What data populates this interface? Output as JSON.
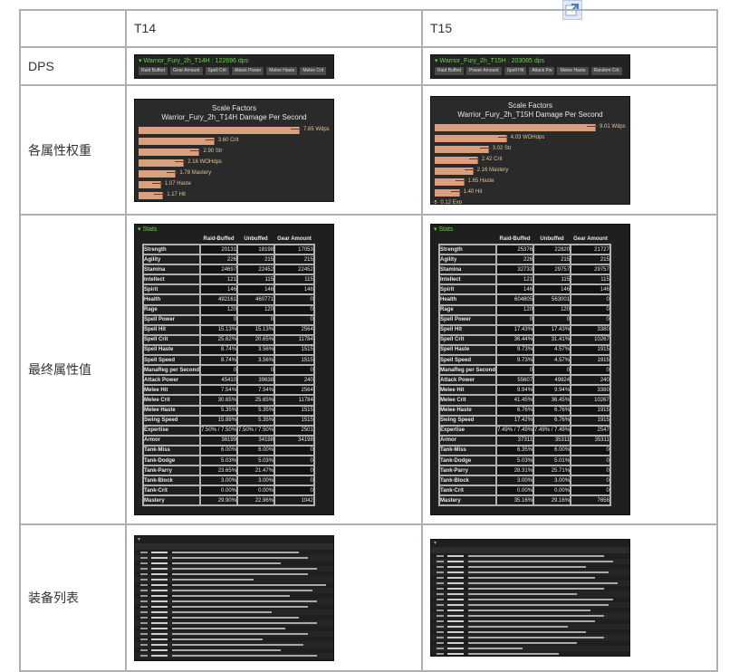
{
  "columns": {
    "t14": "T14",
    "t15": "T15"
  },
  "rows": {
    "dps": "DPS",
    "scale_factors": "各属性权重",
    "final_stats": "最终属性值",
    "gear_list": "装备列表"
  },
  "t14": {
    "dps_title": "Warrior_Fury_2h_T14H : 122696 dps",
    "dps_buttons": [
      "Raid Buffed",
      "Gear Amount",
      "Spell Crit",
      "Attack Power",
      "Melee Haste",
      "Melee Crit"
    ],
    "scale_factors": {
      "title": "Scale Factors",
      "subtitle": "Warrior_Fury_2h_T14H Damage Per Second",
      "items": [
        {
          "label": "7.65 Wdps",
          "value": 7.65
        },
        {
          "label": "3.60 Crit",
          "value": 3.6
        },
        {
          "label": "2.90 Str",
          "value": 2.9
        },
        {
          "label": "2.16 WOHdps",
          "value": 2.16
        },
        {
          "label": "1.78 Mastery",
          "value": 1.78
        },
        {
          "label": "1.07 Haste",
          "value": 1.07
        },
        {
          "label": "1.17 Hit",
          "value": 1.17
        }
      ]
    },
    "stats": {
      "header": "Stats",
      "columns": [
        "Raid-Buffed",
        "Unbuffed",
        "Gear Amount"
      ],
      "rows": [
        {
          "name": "Strength",
          "v": [
            "20131",
            "18198",
            "17053"
          ]
        },
        {
          "name": "Agility",
          "v": [
            "226",
            "215",
            "215"
          ]
        },
        {
          "name": "Stamina",
          "v": [
            "24697",
            "22452",
            "22452"
          ]
        },
        {
          "name": "Intellect",
          "v": [
            "121",
            "115",
            "115"
          ]
        },
        {
          "name": "Spirit",
          "v": [
            "146",
            "146",
            "146"
          ]
        },
        {
          "name": "Health",
          "v": [
            "492161",
            "460771",
            "0"
          ]
        },
        {
          "name": "Rage",
          "v": [
            "120",
            "120",
            "0"
          ]
        },
        {
          "name": "Spell Power",
          "v": [
            "0",
            "0",
            "0"
          ]
        },
        {
          "name": "Spell Hit",
          "v": [
            "15.13%",
            "15.13%",
            "2564"
          ]
        },
        {
          "name": "Spell Crit",
          "v": [
            "25.62%",
            "20.65%",
            "11784"
          ]
        },
        {
          "name": "Spell Haste",
          "v": [
            "8.74%",
            "3.56%",
            "1515"
          ]
        },
        {
          "name": "Spell Speed",
          "v": [
            "8.74%",
            "3.56%",
            "1515"
          ]
        },
        {
          "name": "ManaReg per Second",
          "v": [
            "0",
            "0",
            "0"
          ]
        },
        {
          "name": "Attack Power",
          "v": [
            "45410",
            "39638",
            "240"
          ]
        },
        {
          "name": "Melee Hit",
          "v": [
            "7.54%",
            "7.54%",
            "2564"
          ]
        },
        {
          "name": "Melee Crit",
          "v": [
            "30.65%",
            "25.65%",
            "11784"
          ]
        },
        {
          "name": "Melee Haste",
          "v": [
            "5.35%",
            "5.35%",
            "1515"
          ]
        },
        {
          "name": "Swing Speed",
          "v": [
            "15.88%",
            "5.35%",
            "1515"
          ]
        },
        {
          "name": "Expertise",
          "v": [
            "7.50% / 7.50%",
            "7.50% / 7.50%",
            "2501"
          ]
        },
        {
          "name": "Armor",
          "v": [
            "36199",
            "34198",
            "34198"
          ]
        },
        {
          "name": "Tank-Miss",
          "v": [
            "6.00%",
            "6.00%",
            "0"
          ]
        },
        {
          "name": "Tank-Dodge",
          "v": [
            "5.03%",
            "5.03%",
            "0"
          ]
        },
        {
          "name": "Tank-Parry",
          "v": [
            "23.65%",
            "21.47%",
            "0"
          ]
        },
        {
          "name": "Tank-Block",
          "v": [
            "3.00%",
            "3.00%",
            "0"
          ]
        },
        {
          "name": "Tank-Crit",
          "v": [
            "0.00%",
            "0.00%",
            "0"
          ]
        },
        {
          "name": "Mastery",
          "v": [
            "29.90%",
            "22.96%",
            "1042"
          ]
        }
      ]
    }
  },
  "t15": {
    "dps_title": "Warrior_Fury_2h_T15H : 203085 dps",
    "dps_buttons": [
      "Raid Buffed",
      "Power Amount",
      "Spell Hit",
      "Attack Pw",
      "Melee Haste",
      "Random Crit"
    ],
    "scale_factors": {
      "title": "Scale Factors",
      "subtitle": "Warrior_Fury_2h_T15H Damage Per Second",
      "items": [
        {
          "label": "9.01 Wdps",
          "value": 9.01
        },
        {
          "label": "4.03 WOHdps",
          "value": 4.03
        },
        {
          "label": "3.02 Str",
          "value": 3.02
        },
        {
          "label": "2.42 Crit",
          "value": 2.42
        },
        {
          "label": "2.16 Mastery",
          "value": 2.16
        },
        {
          "label": "1.65 Haste",
          "value": 1.65
        },
        {
          "label": "1.40 Hit",
          "value": 1.4
        },
        {
          "label": "0.12 Exp",
          "value": 0.12
        }
      ]
    },
    "stats": {
      "header": "Stats",
      "columns": [
        "Raid-Buffed",
        "Unbuffed",
        "Gear Amount"
      ],
      "rows": [
        {
          "name": "Strength",
          "v": [
            "25376",
            "22820",
            "21727"
          ]
        },
        {
          "name": "Agility",
          "v": [
            "226",
            "215",
            "215"
          ]
        },
        {
          "name": "Stamina",
          "v": [
            "32733",
            "29757",
            "29757"
          ]
        },
        {
          "name": "Intellect",
          "v": [
            "121",
            "115",
            "115"
          ]
        },
        {
          "name": "Spirit",
          "v": [
            "146",
            "146",
            "146"
          ]
        },
        {
          "name": "Health",
          "v": [
            "604805",
            "563001",
            "0"
          ]
        },
        {
          "name": "Rage",
          "v": [
            "120",
            "120",
            "0"
          ]
        },
        {
          "name": "Spell Power",
          "v": [
            "0",
            "0",
            "0"
          ]
        },
        {
          "name": "Spell Hit",
          "v": [
            "17.43%",
            "17.43%",
            "3380"
          ]
        },
        {
          "name": "Spell Crit",
          "v": [
            "36.44%",
            "31.41%",
            "10267"
          ]
        },
        {
          "name": "Spell Haste",
          "v": [
            "9.73%",
            "4.57%",
            "1915"
          ]
        },
        {
          "name": "Spell Speed",
          "v": [
            "9.73%",
            "4.57%",
            "1915"
          ]
        },
        {
          "name": "ManaReg per Second",
          "v": [
            "0",
            "0",
            "0"
          ]
        },
        {
          "name": "Attack Power",
          "v": [
            "55607",
            "49824",
            "240"
          ]
        },
        {
          "name": "Melee Hit",
          "v": [
            "9.94%",
            "9.94%",
            "3380"
          ]
        },
        {
          "name": "Melee Crit",
          "v": [
            "41.45%",
            "36.45%",
            "10267"
          ]
        },
        {
          "name": "Melee Haste",
          "v": [
            "6.76%",
            "6.76%",
            "1915"
          ]
        },
        {
          "name": "Swing Speed",
          "v": [
            "17.42%",
            "6.76%",
            "1915"
          ]
        },
        {
          "name": "Expertise",
          "v": [
            "7.49% / 7.49%",
            "7.49% / 7.49%",
            "2547"
          ]
        },
        {
          "name": "Armor",
          "v": [
            "37311",
            "35311",
            "35311"
          ]
        },
        {
          "name": "Tank-Miss",
          "v": [
            "6.35%",
            "6.00%",
            "0"
          ]
        },
        {
          "name": "Tank-Dodge",
          "v": [
            "5.03%",
            "5.01%",
            "0"
          ]
        },
        {
          "name": "Tank-Parry",
          "v": [
            "28.31%",
            "25.71%",
            "0"
          ]
        },
        {
          "name": "Tank-Block",
          "v": [
            "3.00%",
            "3.00%",
            "0"
          ]
        },
        {
          "name": "Tank-Crit",
          "v": [
            "0.00%",
            "0.00%",
            "0"
          ]
        },
        {
          "name": "Mastery",
          "v": [
            "35.16%",
            "29.16%",
            "7656"
          ]
        }
      ]
    }
  },
  "colors": {
    "panel_bg": "#232323",
    "header_green": "#67d04b",
    "bar_fill": "#d9a080",
    "bar_label": "#e0c49a",
    "table_border": "#b0b0b0"
  }
}
